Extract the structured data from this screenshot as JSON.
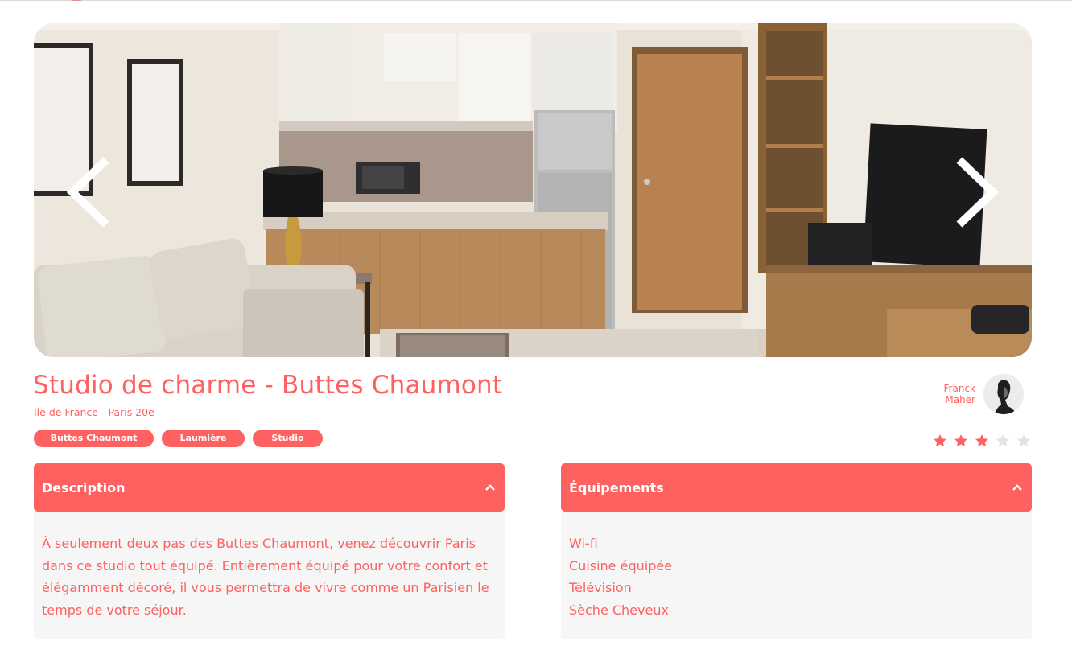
{
  "carousel": {
    "prev_icon": "chevron-left-icon",
    "next_icon": "chevron-right-icon"
  },
  "listing": {
    "title": "Studio de charme - Buttes Chaumont",
    "location": "Ile de France - Paris 20e",
    "tags": [
      "Buttes Chaumont",
      "Laumière",
      "Studio"
    ],
    "host": {
      "first_name": "Franck",
      "last_name": "Maher"
    },
    "rating": 3,
    "rating_max": 5
  },
  "collapses": {
    "description": {
      "title": "Description",
      "icon": "chevron-up-icon",
      "text": "À seulement deux pas des Buttes Chaumont, venez découvrir Paris dans ce studio tout équipé. Entièrement équipé pour votre confort et élégamment décoré, il vous permettra de vivre comme un Parisien le temps de votre séjour."
    },
    "equipments": {
      "title": "Équipements",
      "icon": "chevron-up-icon",
      "items": [
        "Wi-fi",
        "Cuisine équipée",
        "Télévision",
        "Sèche Cheveux"
      ]
    }
  },
  "colors": {
    "accent": "#ff6060",
    "panel_bg": "#f6f6f6",
    "star_empty": "#e3e3e3"
  }
}
